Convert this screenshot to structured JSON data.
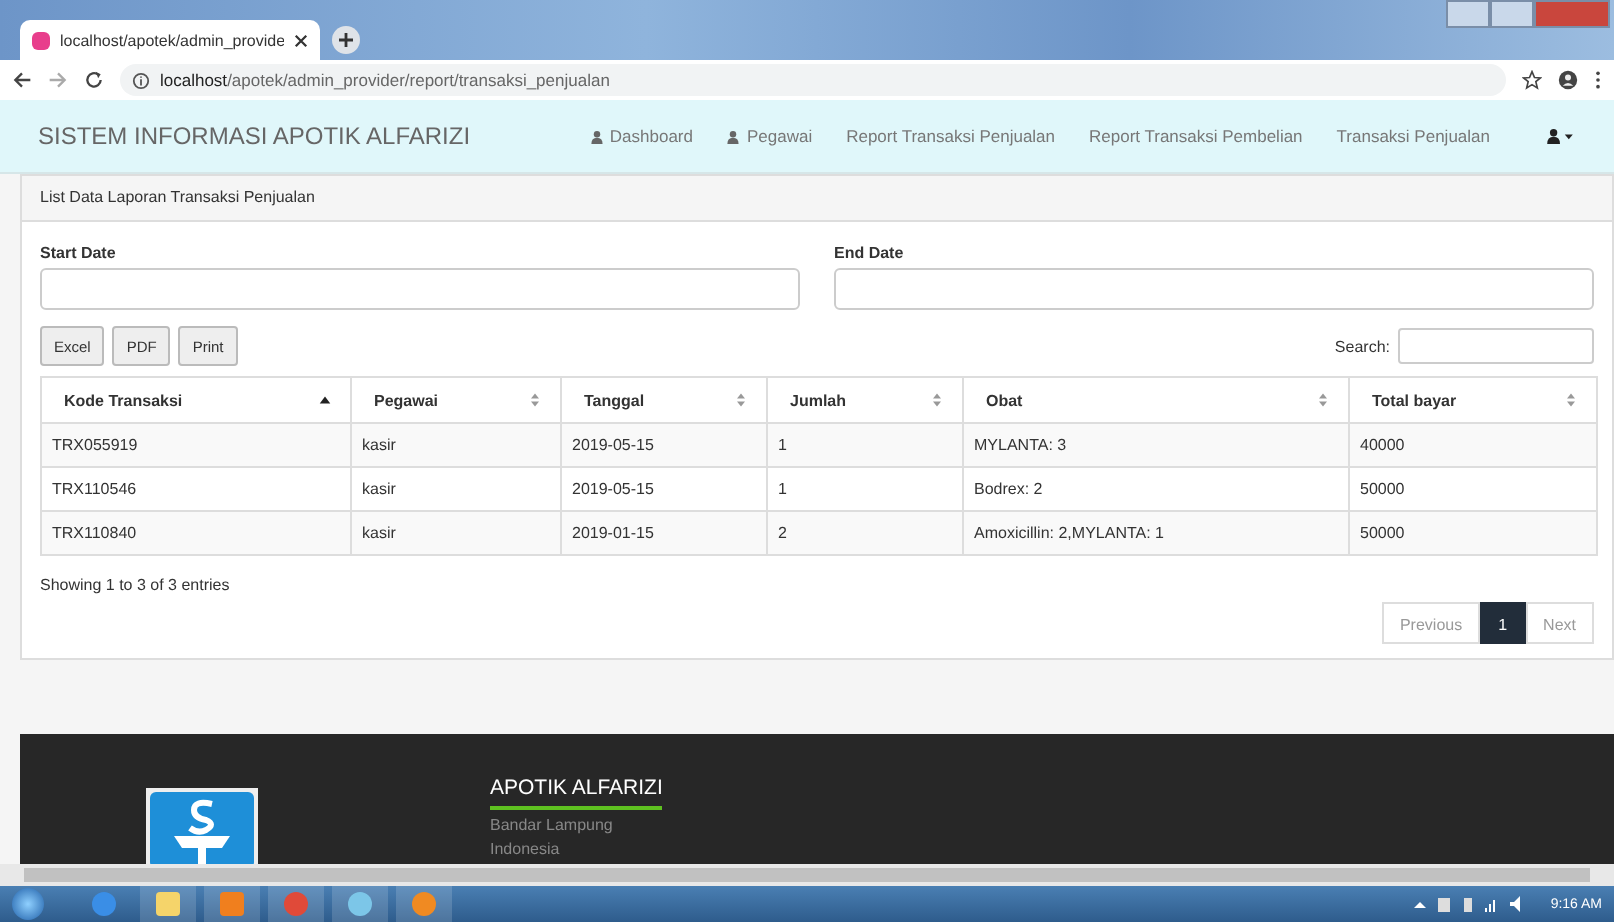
{
  "browser": {
    "tab_title": "localhost/apotek/admin_provide",
    "address_host": "localhost",
    "address_path": "/apotek/admin_provider/report/transaksi_penjualan"
  },
  "navbar": {
    "brand": "SISTEM INFORMASI APOTIK ALFARIZI",
    "items": [
      {
        "label": "Dashboard",
        "kind": "icon-link"
      },
      {
        "label": "Pegawai",
        "kind": "icon-link"
      },
      {
        "label": "Report Transaksi Penjualan",
        "kind": "text-link"
      },
      {
        "label": "Report Transaksi Pembelian",
        "kind": "text-link"
      },
      {
        "label": "Transaksi Penjualan",
        "kind": "text-link"
      }
    ]
  },
  "panel": {
    "heading": "List Data Laporan Transaksi Penjualan",
    "start_date": {
      "label": "Start Date"
    },
    "end_date": {
      "label": "End Date"
    },
    "export_buttons": [
      "Excel",
      "PDF",
      "Print"
    ],
    "search_label": "Search:",
    "table": {
      "columns": [
        {
          "label": "Kode Transaksi",
          "sorted": true
        },
        {
          "label": "Pegawai",
          "sorted": false
        },
        {
          "label": "Tanggal",
          "sorted": false
        },
        {
          "label": "Jumlah",
          "sorted": false
        },
        {
          "label": "Obat",
          "sorted": false
        },
        {
          "label": "Total bayar",
          "sorted": false
        }
      ],
      "rows": [
        [
          "TRX055919",
          "kasir",
          "2019-05-15",
          "1",
          "MYLANTA: 3",
          "40000"
        ],
        [
          "TRX110546",
          "kasir",
          "2019-05-15",
          "1",
          "Bodrex: 2",
          "50000"
        ],
        [
          "TRX110840",
          "kasir",
          "2019-01-15",
          "2",
          "Amoxicillin: 2,MYLANTA: 1",
          "50000"
        ]
      ]
    },
    "info": "Showing 1 to 3 of 3 entries",
    "pagination": [
      {
        "label": "Previous",
        "selected": false
      },
      {
        "label": "1",
        "selected": true
      },
      {
        "label": "Next",
        "selected": false
      }
    ]
  },
  "footer": {
    "title": "APOTIK ALFARIZI",
    "lines": [
      "Bandar Lampung",
      "Indonesia"
    ]
  },
  "taskbar": {
    "clock": "9:16 AM"
  }
}
